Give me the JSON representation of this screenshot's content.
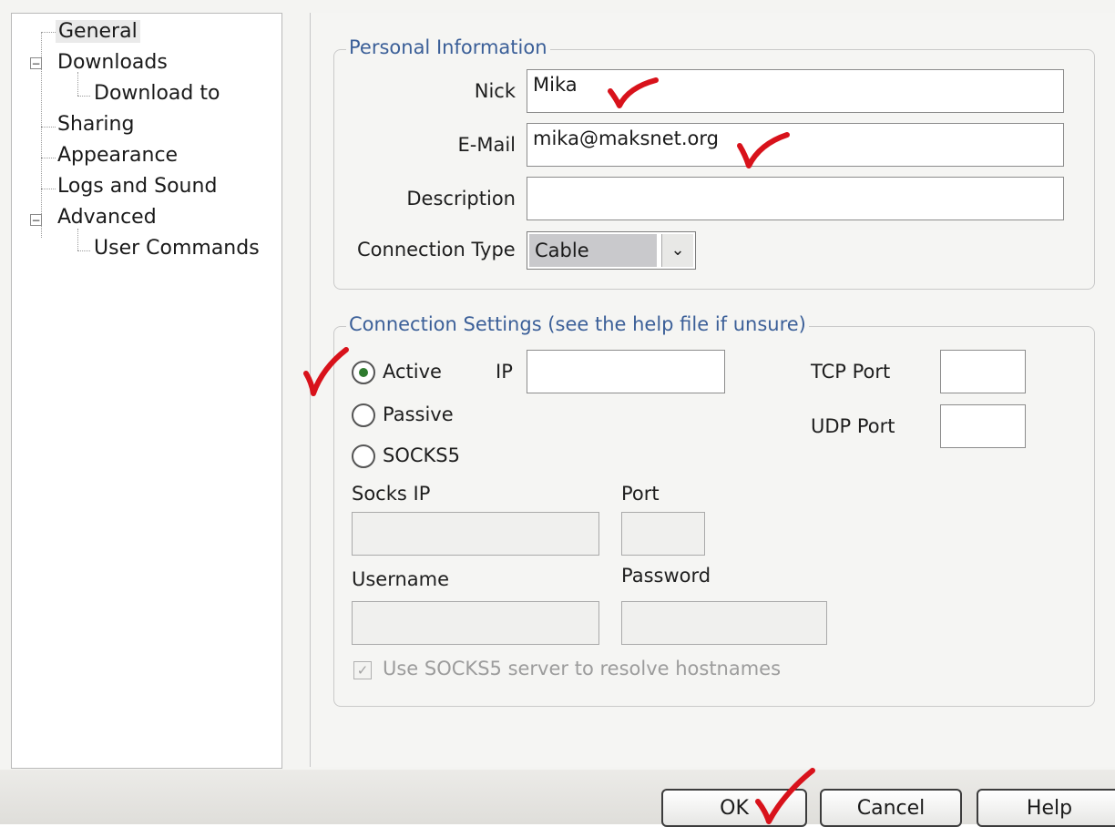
{
  "tree": {
    "items": [
      {
        "label": "General",
        "selected": true
      },
      {
        "label": "Downloads",
        "expander": "−"
      },
      {
        "label": "Download to"
      },
      {
        "label": "Sharing"
      },
      {
        "label": "Appearance"
      },
      {
        "label": "Logs and Sound"
      },
      {
        "label": "Advanced",
        "expander": "−"
      },
      {
        "label": "User Commands"
      }
    ]
  },
  "personal": {
    "title": "Personal Information",
    "nick_label": "Nick",
    "nick_value": "Mika",
    "email_label": "E-Mail",
    "email_value": "mika@maksnet.org",
    "description_label": "Description",
    "description_value": "",
    "connection_type_label": "Connection Type",
    "connection_type_value": "Cable",
    "dropdown_arrow": "⌄"
  },
  "connection": {
    "title": "Connection Settings (see the help file if unsure)",
    "modes": [
      {
        "label": "Active",
        "selected": true
      },
      {
        "label": "Passive",
        "selected": false
      },
      {
        "label": "SOCKS5",
        "selected": false
      }
    ],
    "ip_label": "IP",
    "ip_value": "",
    "tcp_port_label": "TCP Port",
    "tcp_port_value": "",
    "udp_port_label": "UDP Port",
    "udp_port_value": "",
    "socks_ip_label": "Socks IP",
    "port_label": "Port",
    "username_label": "Username",
    "password_label": "Password",
    "resolve_label": "Use SOCKS5 server to resolve hostnames",
    "resolve_checked": true,
    "resolve_mark": "✓"
  },
  "buttons": {
    "ok": "OK",
    "cancel": "Cancel",
    "help": "Help"
  },
  "colors": {
    "group_title": "#3b5f98",
    "annotation_check": "#d8121b"
  }
}
